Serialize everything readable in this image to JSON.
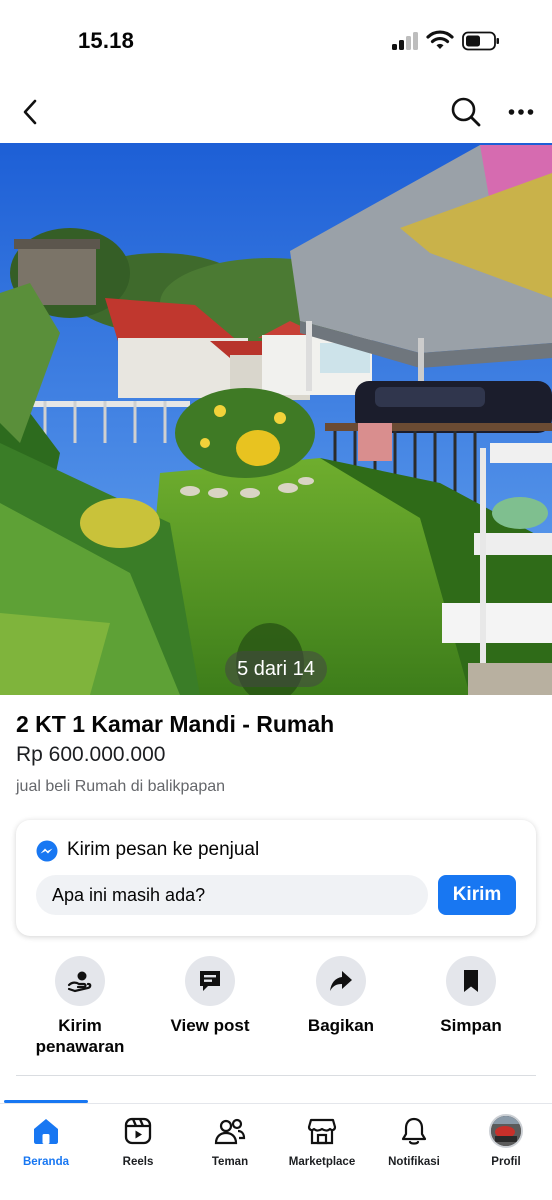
{
  "status_bar": {
    "time": "15.18"
  },
  "photo": {
    "counter": "5 dari 14"
  },
  "listing": {
    "title": "2 KT 1 Kamar Mandi - Rumah",
    "price": "Rp 600.000.000",
    "category": "jual beli Rumah di balikpapan"
  },
  "message": {
    "title": "Kirim pesan ke penjual",
    "input_value": "Apa ini masih ada?",
    "send_label": "Kirim"
  },
  "actions": [
    {
      "label": "Kirim penawaran",
      "icon": "offer-icon"
    },
    {
      "label": "View post",
      "icon": "post-icon"
    },
    {
      "label": "Bagikan",
      "icon": "share-icon"
    },
    {
      "label": "Simpan",
      "icon": "bookmark-icon"
    }
  ],
  "tabs": [
    {
      "label": "Beranda",
      "icon": "home-icon",
      "active": true
    },
    {
      "label": "Reels",
      "icon": "reels-icon"
    },
    {
      "label": "Teman",
      "icon": "friends-icon"
    },
    {
      "label": "Marketplace",
      "icon": "marketplace-icon"
    },
    {
      "label": "Notifikasi",
      "icon": "bell-icon"
    },
    {
      "label": "Profil",
      "icon": "avatar"
    }
  ],
  "colors": {
    "accent": "#1877f2",
    "surface": "#f0f2f5",
    "action_circle": "#e4e6eb"
  }
}
